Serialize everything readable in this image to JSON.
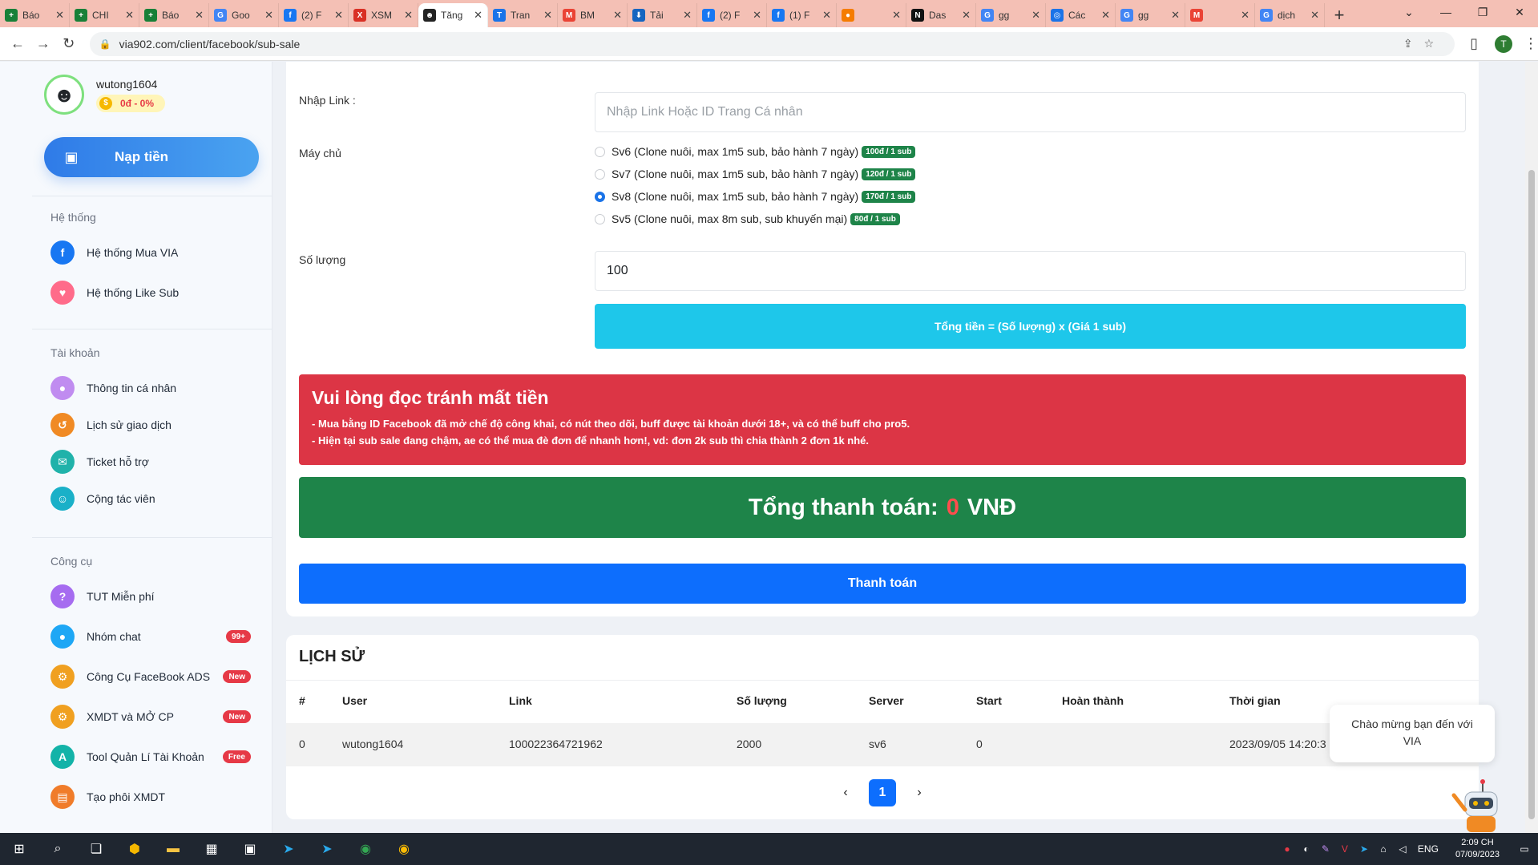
{
  "browser": {
    "tabs": [
      {
        "label": "Báo",
        "color": "#188038",
        "glyph": "+"
      },
      {
        "label": "CHI",
        "color": "#188038",
        "glyph": "+"
      },
      {
        "label": "Báo",
        "color": "#188038",
        "glyph": "+"
      },
      {
        "label": "Goo",
        "color": "#4285f4",
        "glyph": "G"
      },
      {
        "label": "(2) F",
        "color": "#1877f2",
        "glyph": "f"
      },
      {
        "label": "XSM",
        "color": "#d93025",
        "glyph": "X"
      },
      {
        "label": "Tăng",
        "color": "#222222",
        "glyph": "☻"
      },
      {
        "label": "Tran",
        "color": "#1a73e8",
        "glyph": "T"
      },
      {
        "label": "BM",
        "color": "#ea4335",
        "glyph": "M"
      },
      {
        "label": "Tải",
        "color": "#1565c0",
        "glyph": "⬇"
      },
      {
        "label": "(2) F",
        "color": "#1877f2",
        "glyph": "f"
      },
      {
        "label": "(1) F",
        "color": "#1877f2",
        "glyph": "f"
      },
      {
        "label": "",
        "color": "#f57c00",
        "glyph": "●"
      },
      {
        "label": "Das",
        "color": "#111111",
        "glyph": "N"
      },
      {
        "label": "gg",
        "color": "#4285f4",
        "glyph": "G"
      },
      {
        "label": "Các",
        "color": "#1a73e8",
        "glyph": "◎"
      },
      {
        "label": "gg",
        "color": "#4285f4",
        "glyph": "G"
      },
      {
        "label": "",
        "color": "#ea4335",
        "glyph": "M"
      },
      {
        "label": "dịch",
        "color": "#4285f4",
        "glyph": "G"
      }
    ],
    "url": "via902.com/client/facebook/sub-sale"
  },
  "sidebar": {
    "username": "wutong1604",
    "balance": "0đ - 0%",
    "topup_label": "Nạp tiền",
    "sections": [
      {
        "title": "Hệ thống",
        "items": [
          {
            "label": "Hệ thống Mua VIA",
            "icon": "facebook-icon",
            "color": "#1877f2",
            "glyph": "f",
            "badge": ""
          },
          {
            "label": "Hệ thống Like Sub",
            "icon": "heart-icon",
            "color": "#ff6b8a",
            "glyph": "♥",
            "badge": ""
          }
        ]
      },
      {
        "title": "Tài khoản",
        "items": [
          {
            "label": "Thông tin cá nhân",
            "icon": "user-icon",
            "color": "#c08cf0",
            "glyph": "●",
            "badge": ""
          },
          {
            "label": "Lịch sử giao dịch",
            "icon": "history-icon",
            "color": "#f08a24",
            "glyph": "↺",
            "badge": ""
          },
          {
            "label": "Ticket hỗ trợ",
            "icon": "ticket-icon",
            "color": "#20b2aa",
            "glyph": "✉",
            "badge": ""
          },
          {
            "label": "Cộng tác viên",
            "icon": "collaborator-icon",
            "color": "#1ab0c8",
            "glyph": "☺",
            "badge": ""
          }
        ]
      },
      {
        "title": "Công cụ",
        "items": [
          {
            "label": "TUT Miễn phí",
            "icon": "question-icon",
            "color": "#a66cf0",
            "glyph": "?",
            "badge": ""
          },
          {
            "label": "Nhóm chat",
            "icon": "chat-icon",
            "color": "#1ea7f5",
            "glyph": "●",
            "badge": "99+"
          },
          {
            "label": "Công Cụ FaceBook ADS",
            "icon": "gear-icon",
            "color": "#f0a020",
            "glyph": "⚙",
            "badge": "New"
          },
          {
            "label": "XMDT và MỞ CP",
            "icon": "gear-icon",
            "color": "#f0a020",
            "glyph": "⚙",
            "badge": "New"
          },
          {
            "label": "Tool Quản Lí Tài Khoản",
            "icon": "ads-icon",
            "color": "#13b3a8",
            "glyph": "A",
            "badge": "Free"
          },
          {
            "label": "Tạo phôi XMDT",
            "icon": "document-icon",
            "color": "#f07c2a",
            "glyph": "▤",
            "badge": ""
          }
        ]
      }
    ]
  },
  "form": {
    "link_label": "Nhập Link :",
    "link_placeholder": "Nhập Link Hoặc ID Trang Cá nhân",
    "server_label": "Máy chủ",
    "servers": [
      {
        "label": "Sv6 (Clone nuôi, max 1m5 sub, bảo hành 7 ngày)",
        "price": "100đ / 1 sub",
        "checked": false
      },
      {
        "label": "Sv7 (Clone nuôi, max 1m5 sub, bảo hành 7 ngày)",
        "price": "120đ / 1 sub",
        "checked": false
      },
      {
        "label": "Sv8 (Clone nuôi, max 1m5 sub, bảo hành 7 ngày)",
        "price": "170đ / 1 sub",
        "checked": true
      },
      {
        "label": "Sv5 (Clone nuôi, max 8m sub, sub khuyến mại)",
        "price": "80đ / 1 sub",
        "checked": false
      }
    ],
    "quantity_label": "Số lượng",
    "quantity_value": "100",
    "total_formula": "Tổng tiền = (Số lượng) x (Giá 1 sub)",
    "warning_title": "Vui lòng đọc tránh mất tiền",
    "warning_lines": [
      "- Mua bằng ID Facebook đã mở chế độ công khai, có nút theo dõi, buff được tài khoản dưới 18+, và có thể buff cho pro5.",
      "- Hiện tại sub sale đang chậm, ae có thể mua đè đơn để nhanh hơn!, vd: đơn 2k sub thì chia thành 2 đơn 1k nhé."
    ],
    "pay_total_prefix": "Tổng thanh toán:",
    "pay_total_amount": "0",
    "pay_total_currency": "VNĐ",
    "pay_button": "Thanh toán"
  },
  "history": {
    "title": "LỊCH SỬ",
    "columns": [
      "#",
      "User",
      "Link",
      "Số lượng",
      "Server",
      "Start",
      "Hoàn thành",
      "Thời gian"
    ],
    "rows": [
      [
        "0",
        "wutong1604",
        "100022364721962",
        "2000",
        "sv6",
        "0",
        "",
        "2023/09/05 14:20:3"
      ]
    ],
    "pagination": {
      "prev": "‹",
      "current": "1",
      "next": "›"
    }
  },
  "chat": {
    "bubble_line1": "Chào mừng bạn đến với",
    "bubble_line2": "VIA"
  },
  "taskbar": {
    "language": "ENG",
    "time": "2:09 CH",
    "date": "07/09/2023"
  },
  "colors": {
    "accent_blue": "#0d6efd",
    "cyan": "#1ec7ea",
    "danger": "#dc3545",
    "success": "#1e8449"
  }
}
